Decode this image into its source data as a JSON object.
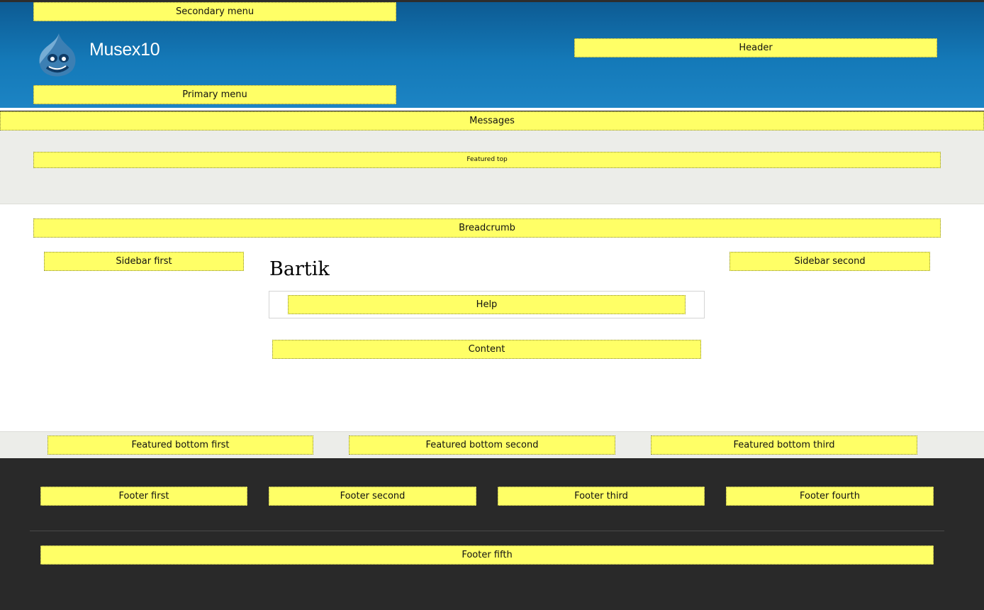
{
  "site": {
    "name": "Musex10",
    "logo": "drupal-drop-icon"
  },
  "colors": {
    "header_top": "#0d5b93",
    "header_bottom": "#1c84c4",
    "region_fill": "#ffff66",
    "light_band": "#ecede9",
    "footer_bg": "#292929"
  },
  "regions": {
    "secondary_menu": "Secondary menu",
    "header": "Header",
    "primary_menu": "Primary menu",
    "messages": "Messages",
    "featured_top": "Featured top",
    "breadcrumb": "Breadcrumb",
    "sidebar_first": "Sidebar first",
    "sidebar_second": "Sidebar second",
    "help": "Help",
    "content": "Content",
    "featured_bottom_first": "Featured bottom first",
    "featured_bottom_second": "Featured bottom second",
    "featured_bottom_third": "Featured bottom third",
    "footer_first": "Footer first",
    "footer_second": "Footer second",
    "footer_third": "Footer third",
    "footer_fourth": "Footer fourth",
    "footer_fifth": "Footer fifth"
  },
  "page": {
    "title": "Bartik"
  }
}
